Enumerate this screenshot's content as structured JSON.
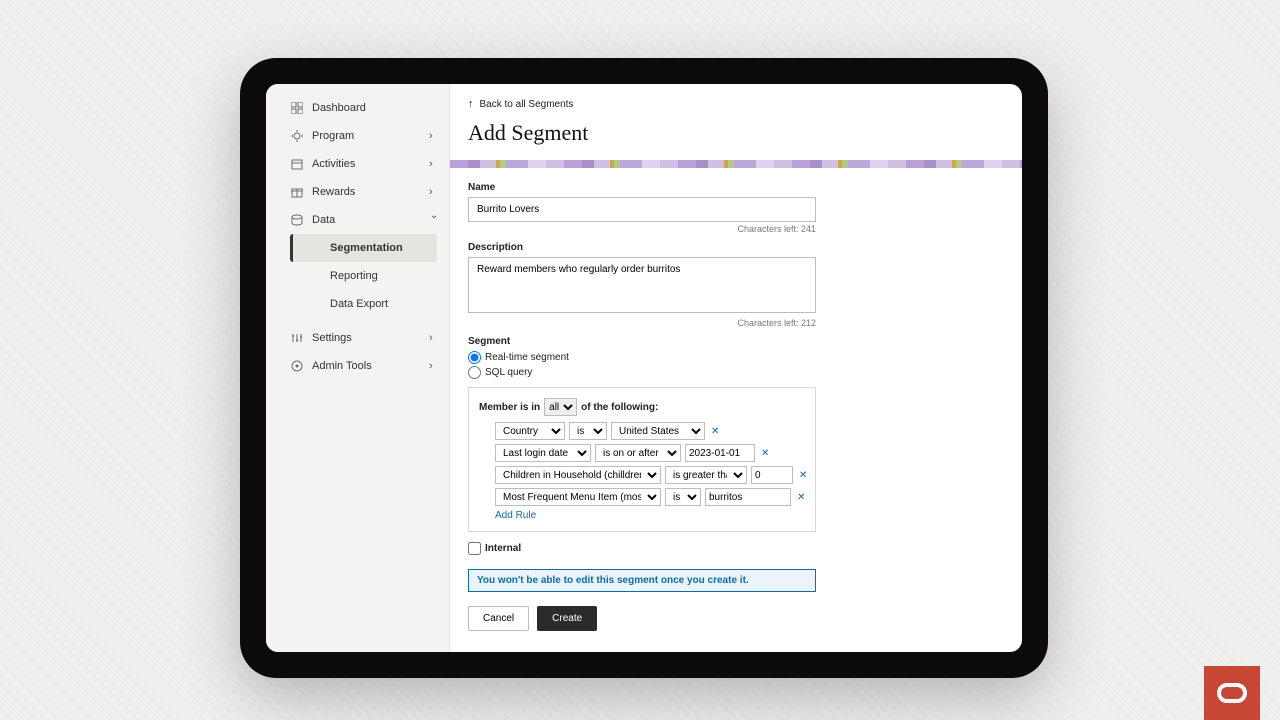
{
  "sidebar": {
    "items": [
      {
        "label": "Dashboard",
        "icon": "dashboard"
      },
      {
        "label": "Program",
        "icon": "program",
        "chevron": "right"
      },
      {
        "label": "Activities",
        "icon": "activities",
        "chevron": "right"
      },
      {
        "label": "Rewards",
        "icon": "rewards",
        "chevron": "right"
      },
      {
        "label": "Data",
        "icon": "data",
        "chevron": "down"
      },
      {
        "label": "Settings",
        "icon": "settings",
        "chevron": "right"
      },
      {
        "label": "Admin Tools",
        "icon": "admin",
        "chevron": "right"
      }
    ],
    "subitems": [
      {
        "label": "Segmentation",
        "active": true
      },
      {
        "label": "Reporting"
      },
      {
        "label": "Data Export"
      }
    ]
  },
  "back_link": "Back to all Segments",
  "page_title": "Add Segment",
  "name_field": {
    "label": "Name",
    "value": "Burrito Lovers",
    "counter": "Characters left: 241"
  },
  "description_field": {
    "label": "Description",
    "value": "Reward members who regularly order burritos",
    "counter": "Characters left: 212"
  },
  "segment_type": {
    "label": "Segment",
    "options": [
      {
        "label": "Real-time segment",
        "selected": true
      },
      {
        "label": "SQL query",
        "selected": false
      }
    ]
  },
  "rules": {
    "prefix": "Member is in",
    "quantifier": "all",
    "suffix": "of the following:",
    "lines": [
      {
        "field": "Country",
        "operator": "is",
        "value": "United States"
      },
      {
        "field": "Last login date",
        "operator": "is on or after",
        "value": "2023-01-01"
      },
      {
        "field": "Children in Household (chilldren_in_household)",
        "operator": "is greater than",
        "value": "0"
      },
      {
        "field": "Most Frequent Menu Item (most_frequent_menu_item)",
        "operator": "is",
        "value": "burritos"
      }
    ],
    "add_rule": "Add Rule"
  },
  "internal_checkbox": {
    "label": "Internal",
    "checked": false
  },
  "warning": "You won't be able to edit this segment once you create it.",
  "actions": {
    "cancel": "Cancel",
    "create": "Create"
  }
}
